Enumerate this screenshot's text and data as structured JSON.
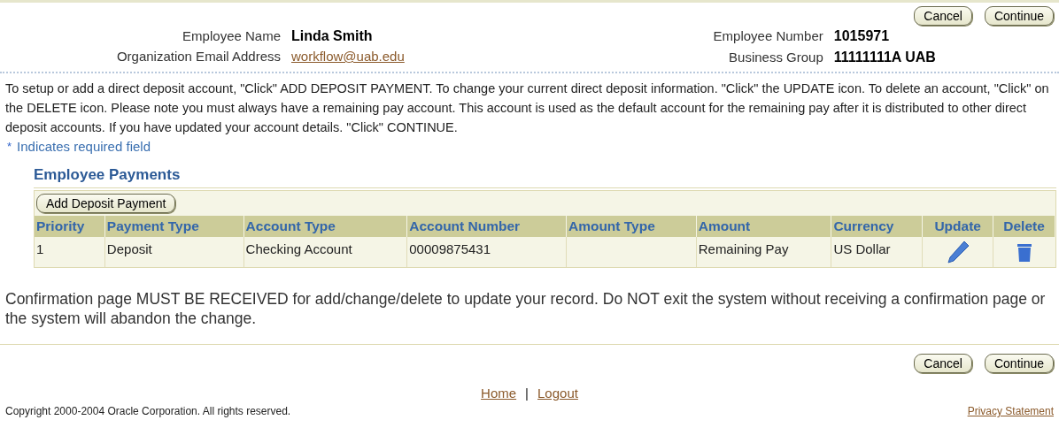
{
  "top_buttons": [
    "Cancel",
    "Continue"
  ],
  "info_left": [
    {
      "label": "Employee Name",
      "value": "Linda Smith",
      "kind": "bold"
    },
    {
      "label": "Organization Email Address",
      "value": "workflow@uab.edu",
      "kind": "link"
    }
  ],
  "info_right": [
    {
      "label": "Employee Number",
      "value": "1015971",
      "kind": "bold"
    },
    {
      "label": "Business Group",
      "value": "11111111A UAB",
      "kind": "bold"
    }
  ],
  "instructions": "To setup or add a direct deposit account, \"Click\" ADD DEPOSIT PAYMENT. To change your current direct deposit information. \"Click\" the UPDATE icon. To delete an account, \"Click\" on the DELETE icon. Please note you must always have a remaining pay account. This account is used as the default account for the remaining pay after it is distributed to other direct deposit accounts. If you have updated your account details. \"Click\" CONTINUE.",
  "required_marker": "*",
  "required_note": "Indicates required field",
  "section_title": "Employee Payments",
  "add_button": "Add Deposit Payment",
  "table": {
    "columns": [
      "Priority",
      "Payment Type",
      "Account Type",
      "Account Number",
      "Amount Type",
      "Amount",
      "Currency",
      "Update",
      "Delete"
    ],
    "rows": [
      {
        "cells": [
          "1",
          "Deposit",
          "Checking Account",
          "00009875431",
          "",
          "Remaining Pay",
          "US Dollar"
        ]
      }
    ]
  },
  "confirmation": "Confirmation page MUST BE RECEIVED for add/change/delete to update your record. Do NOT exit the system without receiving a confirmation page or the system will abandon the change.",
  "bottom_buttons": [
    "Cancel",
    "Continue"
  ],
  "footer_links": [
    "Home",
    "Logout"
  ],
  "footer_separator": "|",
  "copyright": "Copyright 2000-2004 Oracle Corporation. All rights reserved.",
  "privacy": "Privacy Statement"
}
